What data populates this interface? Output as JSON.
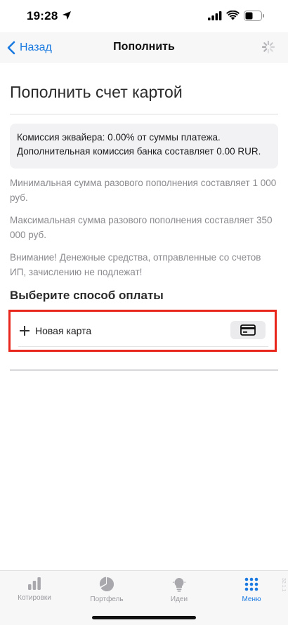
{
  "status_bar": {
    "time": "19:28"
  },
  "nav": {
    "back_label": "Назад",
    "title": "Пополнить"
  },
  "content": {
    "heading": "Пополнить счет картой",
    "commission": {
      "line1": "Комиссия эквайера: 0.00% от суммы платежа.",
      "line2": "Дополнительная комиссия банка составляет 0.00 RUR."
    },
    "min_amount": "Минимальная сумма разового пополнения составляет 1 000 руб.",
    "max_amount": "Максимальная сумма разового пополнения составляет 350 000 руб.",
    "warning": "Внимание! Денежные средства, отправленные со счетов ИП, зачислению не подлежат!",
    "payment_section_title": "Выберите способ оплаты",
    "new_card_label": "Новая карта"
  },
  "tab_bar": {
    "tabs": [
      {
        "label": "Котировки",
        "icon": "bar-chart-icon",
        "active": false
      },
      {
        "label": "Портфель",
        "icon": "pie-chart-icon",
        "active": false
      },
      {
        "label": "Идеи",
        "icon": "lightbulb-icon",
        "active": false
      },
      {
        "label": "Меню",
        "icon": "grid-dots-icon",
        "active": true
      }
    ],
    "version": "32.1.1"
  },
  "colors": {
    "accent": "#1a7ae0",
    "highlight": "#e8261c",
    "muted_text": "#8a8a8f"
  }
}
